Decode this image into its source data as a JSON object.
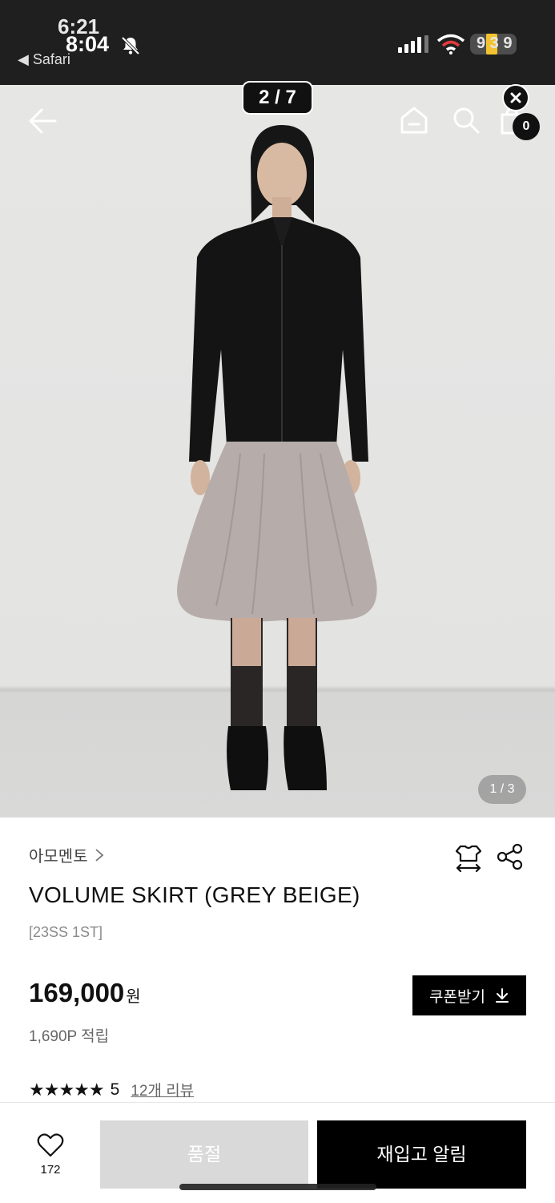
{
  "status_bar": {
    "time_behind": "6:21",
    "time": "8:04",
    "back_app": "◀ Safari",
    "battery": "9 3 9"
  },
  "gallery": {
    "counter": "2 / 7",
    "page_indicator": "1 / 3",
    "cart_count": "0"
  },
  "product": {
    "brand": "아모멘토",
    "title": "VOLUME SKIRT (GREY BEIGE)",
    "season": "[23SS 1ST]",
    "price": "169,000",
    "currency": "원",
    "points": "1,690P 적립",
    "coupon_label": "쿠폰받기",
    "stars": "★★★★★",
    "rating": "5",
    "review_link": "12개 리뷰"
  },
  "bottom_bar": {
    "like_count": "172",
    "soldout_label": "품절",
    "restock_label": "재입고 알림"
  },
  "colors": {
    "status_bg": "#1f1f1f",
    "accent": "#000000",
    "disabled": "#d9d9d9",
    "battery_fill": "#f2c230"
  }
}
